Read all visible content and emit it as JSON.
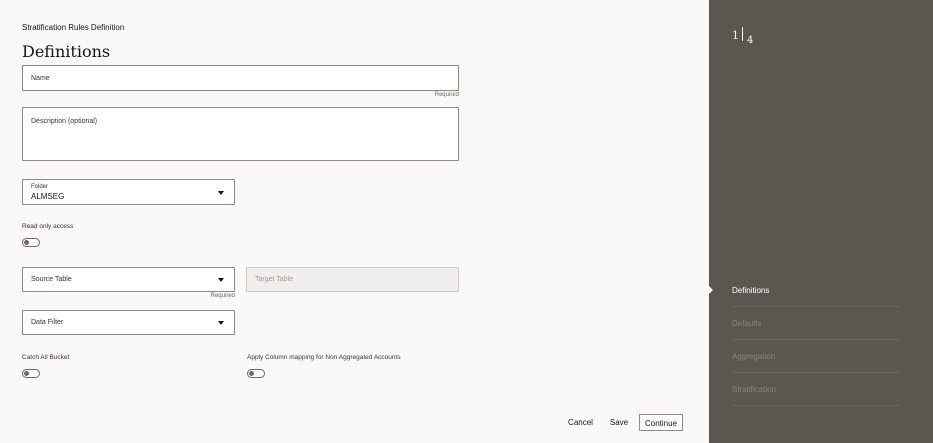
{
  "page": {
    "breadcrumb": "Stratification Rules Definition",
    "title": "Definitions"
  },
  "form": {
    "name": {
      "label": "Name",
      "value": "",
      "hint": "Required"
    },
    "description": {
      "label": "Description (optional)",
      "value": ""
    },
    "folder": {
      "label": "Folder",
      "value": "ALMSEG"
    },
    "read_only": {
      "label": "Read only access",
      "on": false
    },
    "source_table": {
      "label": "Source Table",
      "value": "",
      "hint": "Required"
    },
    "target_table": {
      "label": "Target Table",
      "value": ""
    },
    "data_filter": {
      "label": "Data Filter",
      "value": ""
    },
    "catch_all": {
      "label": "Catch All Bucket",
      "on": false
    },
    "apply_mapping": {
      "label": "Apply Column mapping for Non Aggregated Accounts",
      "on": false
    }
  },
  "actions": {
    "cancel": "Cancel",
    "save": "Save",
    "continue": "Continue"
  },
  "sidebar": {
    "current_step": "1",
    "total_steps": "4",
    "steps": [
      {
        "label": "Definitions",
        "active": true
      },
      {
        "label": "Defaults",
        "active": false
      },
      {
        "label": "Aggregation",
        "active": false
      },
      {
        "label": "Stratification",
        "active": false
      }
    ]
  },
  "colors": {
    "sidebar_bg": "#5c5650",
    "page_bg": "#faf9f7",
    "border": "#8f8b86"
  }
}
